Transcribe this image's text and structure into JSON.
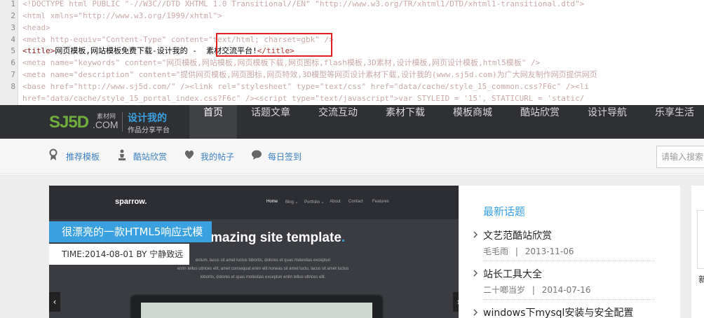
{
  "code": {
    "line_numbers": [
      "1",
      "2",
      "3",
      "4",
      "5",
      "6",
      "7",
      "8"
    ],
    "l1": "<!DOCTYPE html PUBLIC \"-//W3C//DTD XHTML 1.0 Transitional//EN\" \"http://www.w3.org/TR/xhtml1/DTD/xhtml1-transitional.dtd\">",
    "l2": "<html xmlns=\"http://www.w3.org/1999/xhtml\">",
    "l3": "<head>",
    "l4": "<meta http-equiv=\"Content-Type\" content=\"text/html; charset=gbk\" />",
    "l5_open": "<title>",
    "l5_text": "网页模板,网站模板免费下载-设计我的 -  素材交流平台!",
    "l5_close": "</title>",
    "l6": "<meta name=\"keywords\" content=\"网页模板,网站模板,网页模板下载,网页图标,flash模板,3D素材,设计模板,网页设计模板,html5模板\" />",
    "l7": "<meta name=\"description\" content=\"提供网页模板,网页图标,网页特效,3D模型等网页设计素材下载,设计我的(www.sj5d.com)为广大网友制作网页提供网页",
    "l8a": "<base href=\"http://www.sj5d.com/\" /><link rel=\"stylesheet\" type=\"text/css\" href=\"data/cache/style_15_common.css?F6c\" /><li",
    "l8b": "href=\"data/cache/style_15_portal_index.css?F6c\" /><script type=\"text/javascript\">var STYLEID = '15', STATICURL = 'static/"
  },
  "logo": {
    "main": "SJ5D",
    "small": "素材网",
    "com": ".COM",
    "tagline": "设计我的",
    "subtagline": "作品分享平台"
  },
  "nav": {
    "items": [
      "首页",
      "话题文章",
      "交流互动",
      "素材下载",
      "模板商城",
      "酷站欣赏",
      "设计导航",
      "乐享生活"
    ]
  },
  "subnav": {
    "items": [
      "推荐模板",
      "酷站欣赏",
      "我的帖子",
      "每日签到"
    ]
  },
  "search": {
    "placeholder": "请输入搜索"
  },
  "slider": {
    "site_logo": "sparrow.",
    "site_menu": [
      "Home",
      "Blog ⌄",
      "Portfolio ⌄",
      "About",
      "Contact",
      "Features"
    ],
    "hero": "mazing site template",
    "hero_dot": ".",
    "desc1": "entum, lacus sit amet luctus lobortis, dolores et quas molestias excepturi",
    "desc2": "enim tellus ultrices elit, amet consequat enim elit noneas sit amet luctu. lacus sit amet luctus",
    "desc3": "lobortis, dolores et quas molestias excepturi enim tellus ultrices elit.",
    "title": "很漂亮的一款HTML5响应式模板",
    "meta": "TIME:2014-08-01 BY 宁静致远",
    "prev": "‹",
    "next": "›"
  },
  "panel": {
    "title": "最新话题",
    "posts": [
      {
        "title": "文艺范酷站欣赏",
        "author": "毛毛雨",
        "date": "2013-11-06"
      },
      {
        "title": "站长工具大全",
        "author": "二十啷当岁",
        "date": "2014-07-16"
      },
      {
        "title": "windows下mysql安装与安全配置"
      }
    ],
    "separator": "|"
  },
  "right": {
    "text": "新"
  },
  "colors": {
    "nav_bg": "#2f3034",
    "accent": "#3aa0e0",
    "logo_green": "#6fae3d",
    "highlight": "#e02020"
  }
}
